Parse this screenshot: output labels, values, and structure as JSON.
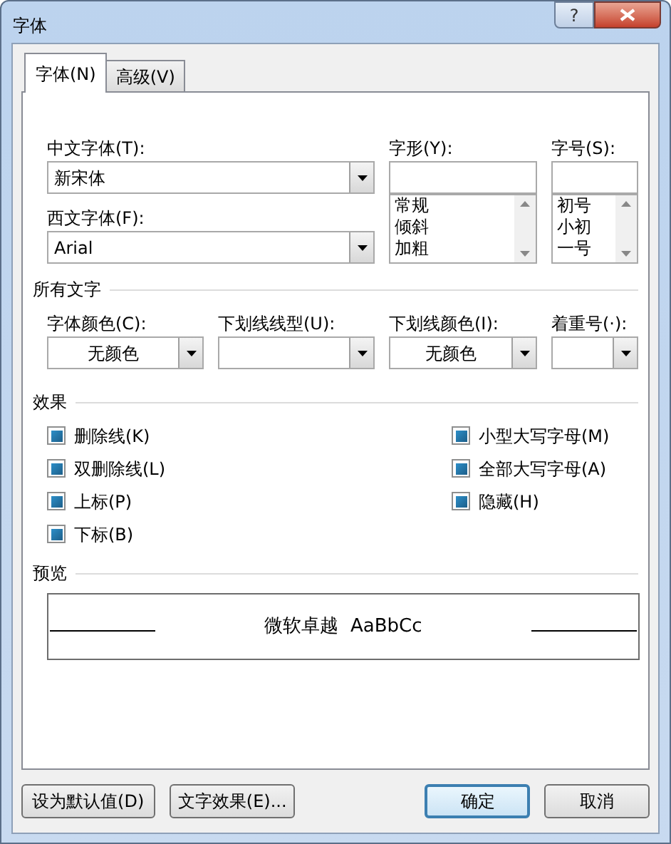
{
  "window": {
    "title": "字体",
    "help": "?"
  },
  "tabs": [
    {
      "label": "字体(N)",
      "selected": true
    },
    {
      "label": "高级(V)",
      "selected": false
    }
  ],
  "chinese_font": {
    "label": "中文字体(T):",
    "value": "新宋体"
  },
  "western_font": {
    "label": "西文字体(F):",
    "value": "Arial"
  },
  "font_style": {
    "label": "字形(Y):",
    "options": [
      "常规",
      "倾斜",
      "加粗"
    ]
  },
  "font_size": {
    "label": "字号(S):",
    "options": [
      "初号",
      "小初",
      "一号"
    ]
  },
  "all_text": {
    "title": "所有文字",
    "combos": [
      {
        "label": "字体颜色(C):",
        "value": "无颜色"
      },
      {
        "label": "下划线线型(U):"
      },
      {
        "label": "下划线颜色(I):",
        "value": "无颜色"
      },
      {
        "label": "着重号(·):"
      }
    ]
  },
  "effects": {
    "title": "效果",
    "left": [
      {
        "label": "删除线(K)",
        "indeterminate": true
      },
      {
        "label": "双删除线(L)",
        "indeterminate": true
      },
      {
        "label": "上标(P)",
        "indeterminate": true
      },
      {
        "label": "下标(B)",
        "indeterminate": true
      }
    ],
    "right": [
      {
        "label": "小型大写字母(M)",
        "indeterminate": true
      },
      {
        "label": "全部大写字母(A)",
        "indeterminate": true
      },
      {
        "label": "隐藏(H)",
        "indeterminate": true
      }
    ]
  },
  "preview": {
    "title": "预览",
    "sample": "微软卓越  AaBbCc"
  },
  "buttons": [
    {
      "label": "设为默认值(D)",
      "default": false
    },
    {
      "label": "文字效果(E)...",
      "default": false
    },
    {
      "label": "确定",
      "default": true
    },
    {
      "label": "取消",
      "default": false
    }
  ]
}
